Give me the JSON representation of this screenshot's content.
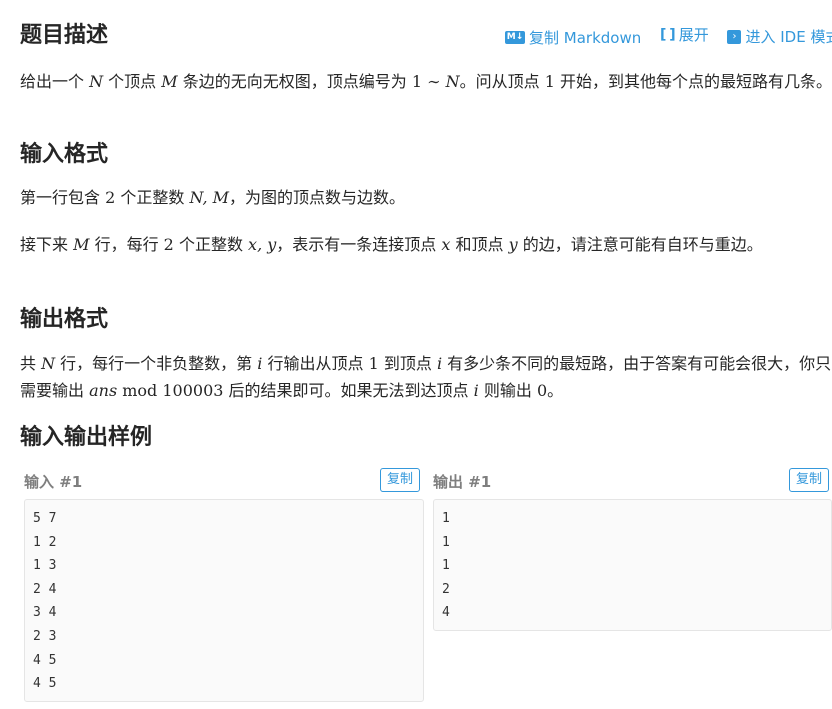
{
  "title": "题目描述",
  "toolbar": {
    "markdown_icon": "M↓",
    "copy_markdown": "复制 Markdown",
    "expand_icon": "[ ]",
    "expand": "展开",
    "ide_icon": "›",
    "ide": "进入 IDE 模式"
  },
  "description": {
    "p1_a": "给出一个 ",
    "p1_N": "N",
    "p1_b": " 个顶点 ",
    "p1_M": "M",
    "p1_c": " 条边的无向无权图，顶点编号为 ",
    "p1_range": "1 ∼ ",
    "p1_N2": "N",
    "p1_d": "。问从顶点 ",
    "p1_one": "1",
    "p1_e": " 开始，到其他每个点的最短路有几条。"
  },
  "input_format": {
    "heading": "输入格式",
    "p1_a": "第一行包含 ",
    "p1_two": "2",
    "p1_b": " 个正整数 ",
    "p1_NM": "N, M",
    "p1_c": "，为图的顶点数与边数。",
    "p2_a": "接下来 ",
    "p2_M": "M",
    "p2_b": " 行，每行 ",
    "p2_two": "2",
    "p2_c": " 个正整数 ",
    "p2_xy": "x, y",
    "p2_d": "，表示有一条连接顶点 ",
    "p2_x": "x",
    "p2_e": " 和顶点 ",
    "p2_y": "y",
    "p2_f": " 的边，请注意可能有自环与重边。"
  },
  "output_format": {
    "heading": "输出格式",
    "p_a": "共 ",
    "p_N": "N",
    "p_b": " 行，每行一个非负整数，第 ",
    "p_i": "i",
    "p_c": " 行输出从顶点 ",
    "p_one": "1",
    "p_d": " 到顶点 ",
    "p_i2": "i",
    "p_e": " 有多少条不同的最短路，由于答案有可能会很大，你只需要输出 ",
    "p_ans": "ans",
    "p_mod": " mod 100003",
    "p_f": " 后的结果即可。如果无法到达顶点 ",
    "p_i3": "i",
    "p_g": " 则输出 ",
    "p_zero": "0",
    "p_h": "。"
  },
  "samples": {
    "heading": "输入输出样例",
    "input_label": "输入 #1",
    "output_label": "输出 #1",
    "copy_label": "复制",
    "input_lines": [
      "5 7",
      "1 2",
      "1 3",
      "2 4",
      "3 4",
      "2 3",
      "4 5",
      "4 5"
    ],
    "output_lines": [
      "1",
      "1",
      "1",
      "2",
      "4"
    ]
  }
}
